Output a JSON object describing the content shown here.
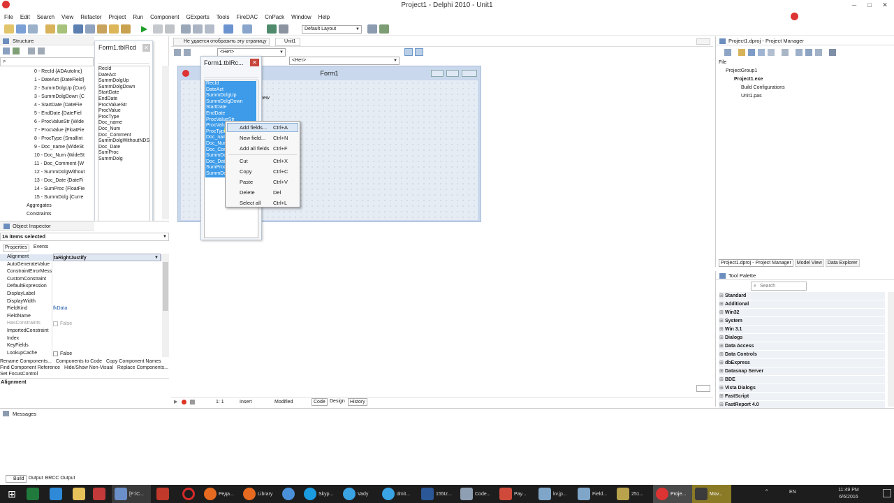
{
  "window": {
    "title": "Project1 - Delphi 2010 - Unit1"
  },
  "menu": [
    "File",
    "Edit",
    "Search",
    "View",
    "Refactor",
    "Project",
    "Run",
    "Component",
    "GExperts",
    "Tools",
    "FireDAC",
    "CnPack",
    "Window",
    "Help"
  ],
  "toolbar": {
    "layout": "Default Layout"
  },
  "structure": {
    "title": "Structure",
    "items": [
      "0 - RecId {ADAutoInc}",
      "1 - DateAct {DateField}",
      "2 - SummDolgUp {Curr}",
      "3 - SummDolgDown {C",
      "4 - StartDate {DateFie",
      "5 - EndDate {DateFiel",
      "6 - ProcValueStr {Wide",
      "7 - ProcValue {FloatFie",
      "8 - ProcType {SmallInt",
      "9 - Doc_name {WideSt",
      "10 - Doc_Num {WideSt",
      "11 - Doc_Comment {W",
      "12 - SummDolgWithout",
      "13 - Doc_Date {DateFi",
      "14 - SumProc {FloatFie",
      "15 - SummDolg {Curre"
    ],
    "aggregates": "Aggregates",
    "constraints": "Constraints"
  },
  "fields_editor": {
    "title": "Form1.tblRcd",
    "items": [
      "RecId",
      "DateAct",
      "SummDolgUp",
      "SummDolgDown",
      "StartDate",
      "EndDate",
      "ProcValueStr",
      "ProcValue",
      "ProcType",
      "Doc_name",
      "Doc_Num",
      "Doc_Comment",
      "SummDolgWithoutNDS",
      "Doc_Date",
      "SumProc",
      "SummDolg"
    ]
  },
  "fields_editor2": {
    "title": "Form1.tblRc...",
    "items": [
      "RecId",
      "DateAct",
      "SummDolgUp",
      "SummDolgDown",
      "StartDate",
      "EndDate",
      "ProcValueStr",
      "ProcValue",
      "ProcType",
      "Doc_nam",
      "Doc_Num",
      "Doc_Com",
      "SummDo",
      "Doc_Date",
      "SumProc",
      "SummDo"
    ]
  },
  "editor_tabs": {
    "tab1": "Не удается отобразить эту страницу",
    "tab2": "Unit1",
    "combo1": "<Нет>",
    "combo2": "<Нет>"
  },
  "form": {
    "title": "Form1",
    "new_label": "new"
  },
  "context_menu": [
    {
      "label": "Add fields...",
      "key": "Ctrl+A"
    },
    {
      "label": "New field...",
      "key": "Ctrl+N"
    },
    {
      "label": "Add all fields",
      "key": "Ctrl+F"
    },
    {
      "label": "Cut",
      "key": "Ctrl+X"
    },
    {
      "label": "Copy",
      "key": "Ctrl+C"
    },
    {
      "label": "Paste",
      "key": "Ctrl+V"
    },
    {
      "label": "Delete",
      "key": "Del"
    },
    {
      "label": "Select all",
      "key": "Ctrl+L"
    }
  ],
  "object_inspector": {
    "title": "Object Inspector",
    "selected": "16 items selected",
    "tab_properties": "Properties",
    "tab_events": "Events",
    "props": [
      "Alignment",
      "AutoGenerateValue",
      "ConstraintErrorMess",
      "CustomConstraint",
      "DefaultExpression",
      "DisplayLabel",
      "DisplayWidth",
      "FieldKind",
      "FieldName",
      "HasConstraints",
      "ImportedConstraint",
      "Index",
      "KeyFields",
      "LookupCache"
    ],
    "alignment_value": "taRightJustify",
    "fieldkind_value": "fkData",
    "false_value": "False",
    "actions": [
      "Rename Components...",
      "Components to Code",
      "Copy Component Names",
      "Find Component Reference",
      "Hide/Show Non-Visual",
      "Replace Components...",
      "Set FocusControl"
    ],
    "status": "Alignment"
  },
  "project_manager": {
    "title": "Project1.dproj - Project Manager",
    "file_label": "File",
    "items": [
      "ProjectGroup1",
      "Project1.exe",
      "Build Configurations",
      "Unit1.pas"
    ],
    "tabs": [
      "Project1.dproj - Project Manager",
      "Model View",
      "Data Explorer"
    ]
  },
  "tool_palette": {
    "title": "Tool Palette",
    "search_placeholder": "Search",
    "categories": [
      "Standard",
      "Additional",
      "Win32",
      "System",
      "Win 3.1",
      "Dialogs",
      "Data Access",
      "Data Controls",
      "dbExpress",
      "Datasnap Server",
      "BDE",
      "Vista Dialogs",
      "FastScript",
      "FastReport 4.0"
    ]
  },
  "statusbar": {
    "pos": "1: 1",
    "insert": "Insert",
    "modified": "Modified",
    "tabs": [
      "Code",
      "Design",
      "History"
    ]
  },
  "messages": {
    "title": "Messages",
    "tabs": [
      "Build",
      "Output",
      "BRCC Output"
    ]
  },
  "taskbar": {
    "items": [
      "[F:\\C...",
      "",
      "Реда...",
      "Library",
      "",
      "Skyp...",
      "Vady",
      "dmit...",
      "155tz...",
      "Code...",
      "Pay...",
      "kv.jp...",
      "Field...",
      "251...",
      "Proje...",
      "Mov..."
    ],
    "lang": "EN",
    "time": "11:49 PM",
    "date": "6/6/2016"
  }
}
